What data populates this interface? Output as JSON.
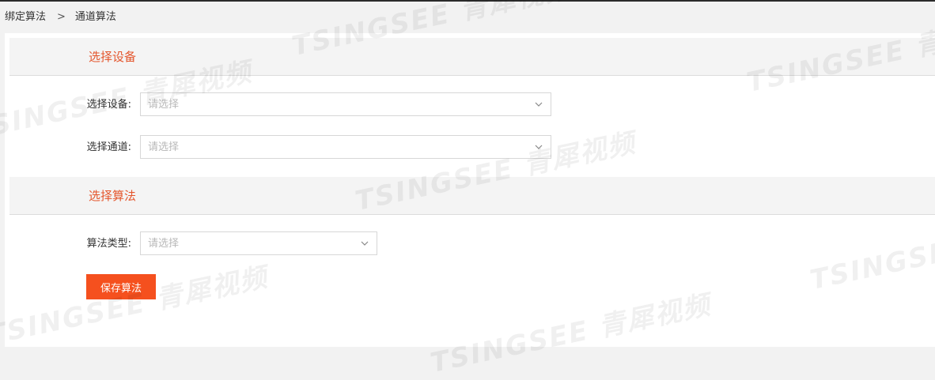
{
  "breadcrumb": {
    "parent": "绑定算法",
    "separator": ">",
    "current": "通道算法"
  },
  "sections": {
    "device": {
      "title": "选择设备"
    },
    "algorithm": {
      "title": "选择算法"
    }
  },
  "form": {
    "device": {
      "label": "选择设备:",
      "placeholder": "请选择"
    },
    "channel": {
      "label": "选择通道:",
      "placeholder": "请选择"
    },
    "algo_type": {
      "label": "算法类型:",
      "placeholder": "请选择"
    }
  },
  "actions": {
    "save_label": "保存算法"
  },
  "watermark": {
    "text": "TSINGSEE 青犀视频"
  },
  "colors": {
    "accent": "#f5501e",
    "section_title": "#e4572e"
  }
}
